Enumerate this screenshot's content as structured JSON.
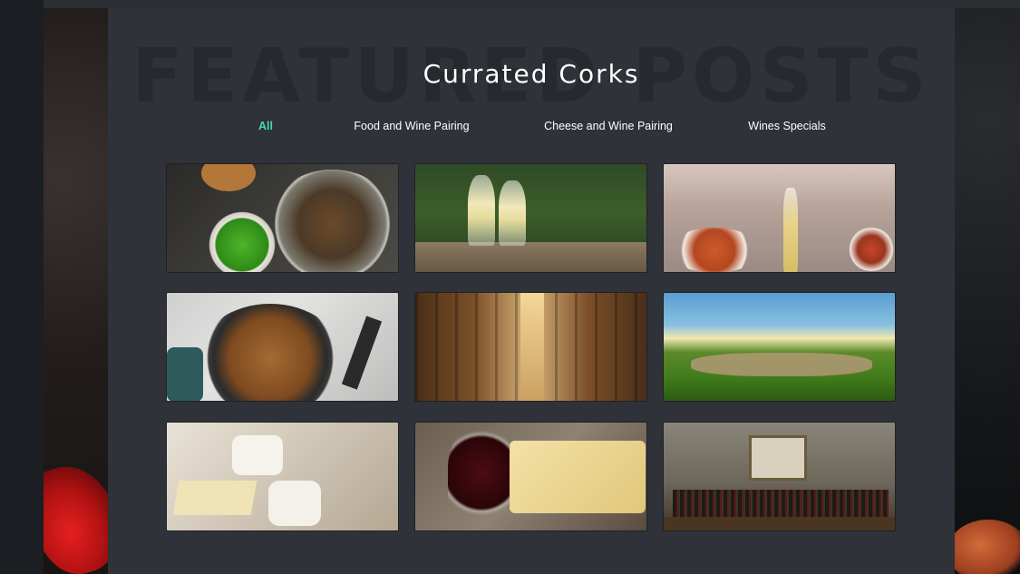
{
  "heading": {
    "background_text": "FEATURED POSTS",
    "title": "Currated Corks"
  },
  "filters": [
    {
      "label": "All",
      "active": true
    },
    {
      "label": "Food and Wine Pairing",
      "active": false
    },
    {
      "label": "Cheese and Wine Pairing",
      "active": false
    },
    {
      "label": "Wines Specials",
      "active": false
    }
  ],
  "colors": {
    "accent": "#46d6b0",
    "panel": "#2f3238",
    "page_background": "#1e2126",
    "text": "#ffffff"
  }
}
